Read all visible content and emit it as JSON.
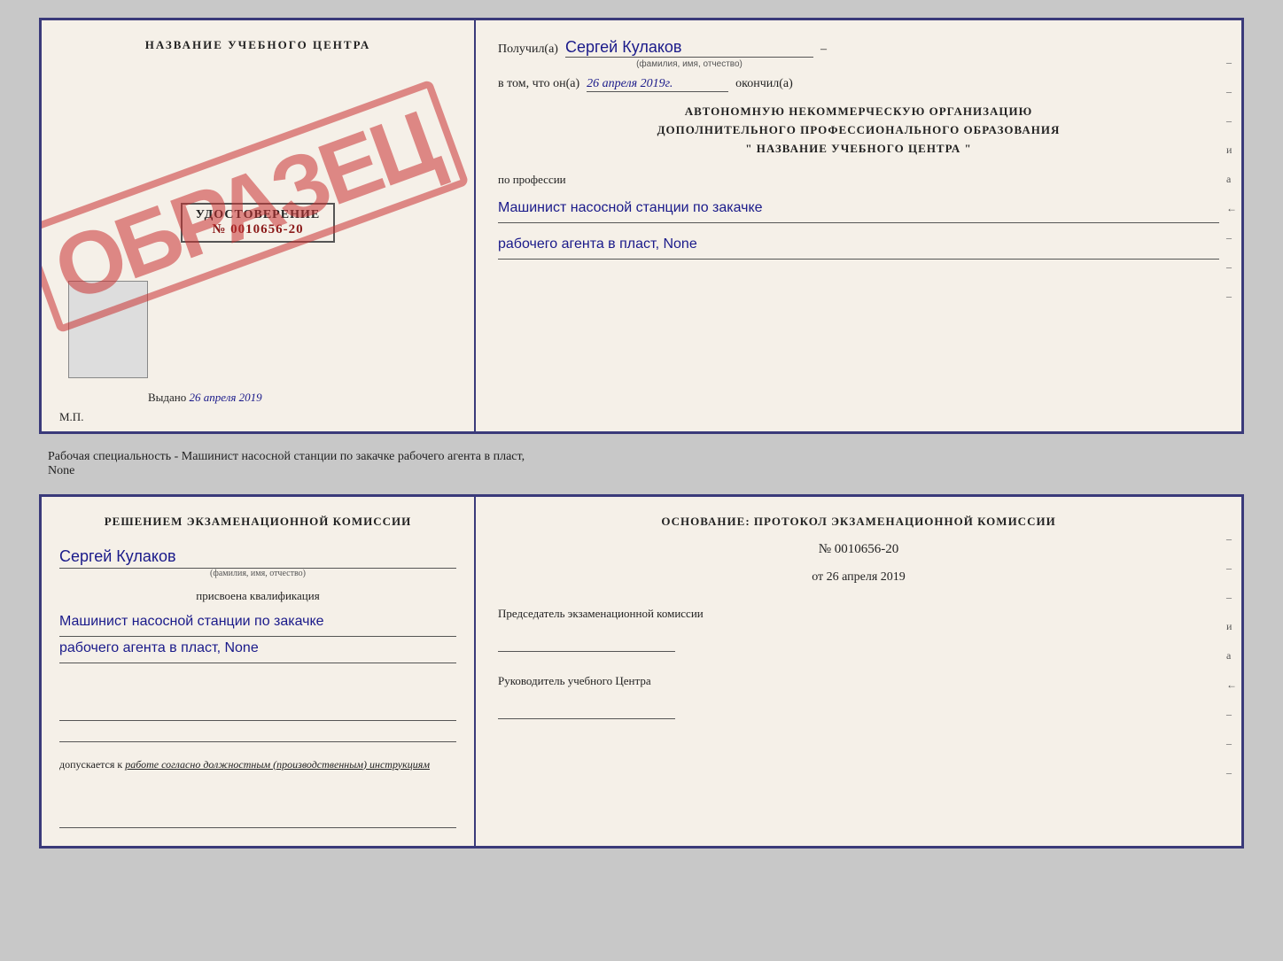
{
  "top_cert": {
    "left": {
      "title": "НАЗВАНИЕ УЧЕБНОГО ЦЕНТРА",
      "stamp": "ОБРАЗЕЦ",
      "udostoverenie_label": "УДОСТОВЕРЕНИЕ",
      "udostoverenie_num": "№ 0010656-20",
      "vydano_label": "Выдано",
      "vydano_date": "26 апреля 2019",
      "mp_label": "М.П."
    },
    "right": {
      "poluchil_label": "Получил(а)",
      "poluchil_name": "Сергей Кулаков",
      "poluchil_subtext": "(фамилия, имя, отчество)",
      "dash1": "–",
      "vtom_label": "в том, что он(а)",
      "vtom_date": "26 апреля 2019г.",
      "okonchil_label": "окончил(а)",
      "org_line1": "АВТОНОМНУЮ НЕКОММЕРЧЕСКУЮ ОРГАНИЗАЦИЮ",
      "org_line2": "ДОПОЛНИТЕЛЬНОГО ПРОФЕССИОНАЛЬНОГО ОБРАЗОВАНИЯ",
      "org_quote": "\"   НАЗВАНИЕ УЧЕБНОГО ЦЕНТРА   \"",
      "po_professii": "по профессии",
      "profession1": "Машинист насосной станции по закачке",
      "profession2": "рабочего агента в пласт, None",
      "side_marks": [
        "-",
        "-",
        "-",
        "и",
        "а",
        "←",
        "-",
        "-",
        "-"
      ]
    }
  },
  "middle": {
    "text": "Рабочая специальность - Машинист насосной станции по закачке рабочего агента в пласт,",
    "text2": "None"
  },
  "bottom_cert": {
    "left": {
      "resheniem": "Решением экзаменационной комиссии",
      "name": "Сергей Кулаков",
      "name_subtext": "(фамилия, имя, отчество)",
      "prisvoena": "присвоена квалификация",
      "qual1": "Машинист насосной станции по закачке",
      "qual2": "рабочего агента в пласт, None",
      "dopusk_prefix": "допускается к",
      "dopusk_text": "работе согласно должностным (производственным) инструкциям"
    },
    "right": {
      "osnovanie": "Основание: протокол экзаменационной комиссии",
      "protocol_num": "№ 0010656-20",
      "protocol_date_prefix": "от",
      "protocol_date": "26 апреля 2019",
      "predsedatel_label": "Председатель экзаменационной комиссии",
      "rukovoditel_label": "Руководитель учебного Центра",
      "side_marks": [
        "-",
        "-",
        "-",
        "и",
        "а",
        "←",
        "-",
        "-",
        "-"
      ]
    }
  }
}
